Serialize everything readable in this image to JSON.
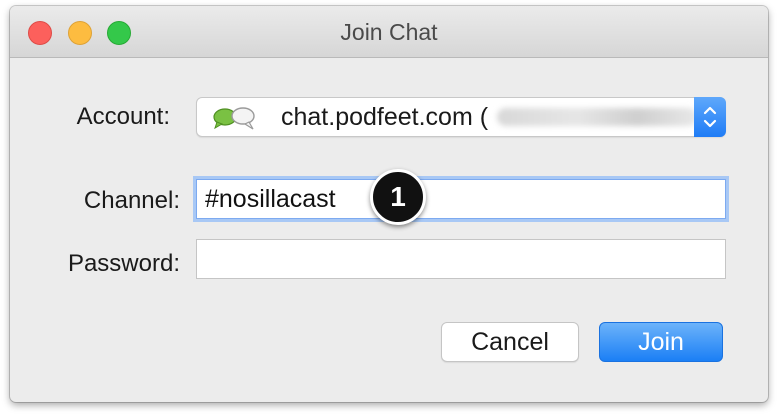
{
  "window": {
    "title": "Join Chat"
  },
  "form": {
    "account_label": "Account:",
    "account_value": "chat.podfeet.com (",
    "channel_label": "Channel:",
    "channel_value": "#nosillacast",
    "password_label": "Password:",
    "password_value": ""
  },
  "annotation": {
    "badge": "1"
  },
  "buttons": {
    "cancel": "Cancel",
    "join": "Join"
  },
  "icons": {
    "account": "chat-bubbles-icon",
    "stepper": "up-down-chevron-icon"
  },
  "colors": {
    "accent": "#1f7cf6",
    "focus_ring": "#a8c8f5",
    "close": "#fc605c",
    "minimize": "#fdbc40",
    "zoom": "#34c84a"
  }
}
